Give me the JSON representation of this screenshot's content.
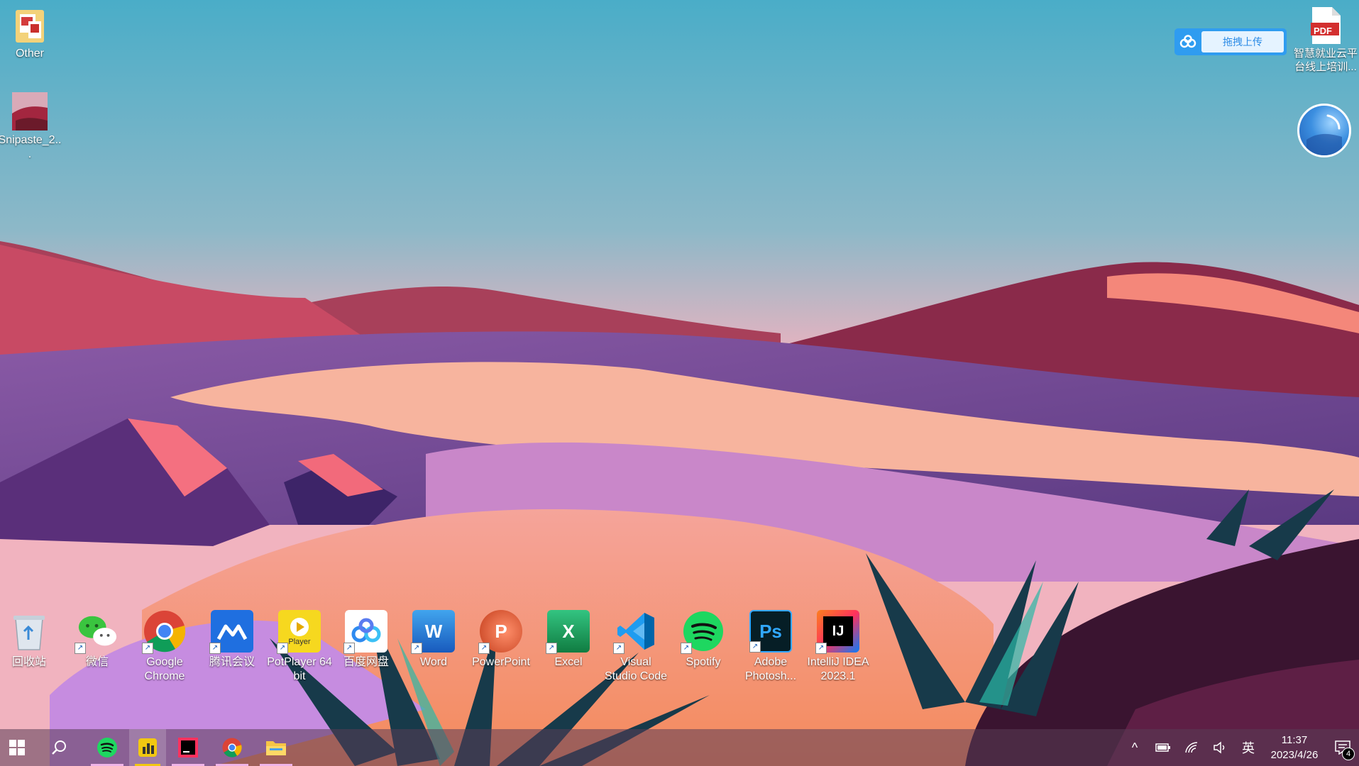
{
  "desktop": {
    "top_icons": [
      {
        "label": "Other"
      },
      {
        "label": "Snipaste_2..."
      }
    ],
    "pdf_icon": {
      "label": "智慧就业云平台线上培训...",
      "badge": "PDF"
    },
    "upload_button": {
      "label": "拖拽上传"
    },
    "dock_icons": [
      {
        "label": "回收站",
        "icon": "recycle-bin-icon"
      },
      {
        "label": "微信",
        "icon": "wechat-icon"
      },
      {
        "label": "Google Chrome",
        "icon": "chrome-icon"
      },
      {
        "label": "腾讯会议",
        "icon": "tencent-meeting-icon"
      },
      {
        "label": "PotPlayer 64 bit",
        "icon": "potplayer-icon",
        "glyph_text": "Player"
      },
      {
        "label": "百度网盘",
        "icon": "baidu-netdisk-icon"
      },
      {
        "label": "Word",
        "icon": "word-icon",
        "glyph_text": "W"
      },
      {
        "label": "PowerPoint",
        "icon": "powerpoint-icon",
        "glyph_text": "P"
      },
      {
        "label": "Excel",
        "icon": "excel-icon",
        "glyph_text": "X"
      },
      {
        "label": "Visual Studio Code",
        "icon": "vscode-icon"
      },
      {
        "label": "Spotify",
        "icon": "spotify-icon"
      },
      {
        "label": "Adobe Photosh...",
        "icon": "photoshop-icon",
        "glyph_text": "Ps"
      },
      {
        "label": "IntelliJ IDEA 2023.1",
        "icon": "intellij-icon",
        "glyph_text": "IJ"
      }
    ]
  },
  "taskbar": {
    "apps": [
      "start-icon",
      "search-icon",
      "spotify-icon",
      "powerbi-icon",
      "intellij-icon",
      "chrome-icon",
      "file-explorer-icon"
    ],
    "tray": {
      "ime": "英",
      "time": "11:37",
      "date": "2023/4/26",
      "notification_count": "4"
    }
  },
  "colors": {
    "sky_top": "#4aadc8",
    "sky_bottom": "#e8b4c4",
    "taskbar": "#5a3c55",
    "accent": "#2f9cf0"
  }
}
